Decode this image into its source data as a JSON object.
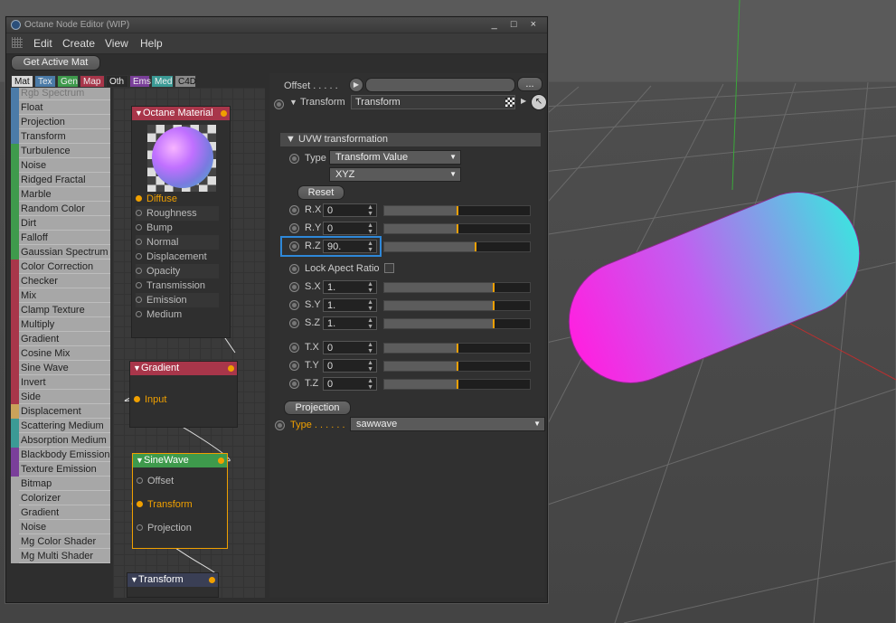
{
  "window": {
    "title": "Octane Node Editor (WIP)",
    "controls": [
      "_",
      "□",
      "×"
    ]
  },
  "menu": [
    "Edit",
    "Create",
    "View",
    "Help"
  ],
  "toolbar": {
    "get_active_mat": "Get Active Mat"
  },
  "tabs": [
    {
      "label": "Mat",
      "color": "#d9d9d9"
    },
    {
      "label": "Tex",
      "color": "#4b7ba8"
    },
    {
      "label": "Gen",
      "color": "#3e9a4c"
    },
    {
      "label": "Map",
      "color": "#a8364a"
    },
    {
      "label": "Oth",
      "color": "#2a2a2a"
    },
    {
      "label": "Ems",
      "color": "#7a3f9a"
    },
    {
      "label": "Med",
      "color": "#3b9a95"
    },
    {
      "label": "C4D",
      "color": "#8a8a8a"
    }
  ],
  "node_list": [
    {
      "label": "Rgb Spectrum",
      "color": "#4b7ba8"
    },
    {
      "label": "Float",
      "color": "#4b7ba8"
    },
    {
      "label": "Projection",
      "color": "#4b7ba8"
    },
    {
      "label": "Transform",
      "color": "#4b7ba8"
    },
    {
      "label": "Turbulence",
      "color": "#3e9a4c"
    },
    {
      "label": "Noise",
      "color": "#3e9a4c"
    },
    {
      "label": "Ridged Fractal",
      "color": "#3e9a4c"
    },
    {
      "label": "Marble",
      "color": "#3e9a4c"
    },
    {
      "label": "Random Color",
      "color": "#3e9a4c"
    },
    {
      "label": "Dirt",
      "color": "#3e9a4c"
    },
    {
      "label": "Falloff",
      "color": "#3e9a4c"
    },
    {
      "label": "Gaussian Spectrum",
      "color": "#3e9a4c"
    },
    {
      "label": "Color Correction",
      "color": "#a8364a"
    },
    {
      "label": "Checker",
      "color": "#a8364a"
    },
    {
      "label": "Mix",
      "color": "#a8364a"
    },
    {
      "label": "Clamp Texture",
      "color": "#a8364a"
    },
    {
      "label": "Multiply",
      "color": "#a8364a"
    },
    {
      "label": "Gradient",
      "color": "#a8364a"
    },
    {
      "label": "Cosine Mix",
      "color": "#a8364a"
    },
    {
      "label": "Sine Wave",
      "color": "#a8364a"
    },
    {
      "label": "Invert",
      "color": "#a8364a"
    },
    {
      "label": "Side",
      "color": "#a8364a"
    },
    {
      "label": "Displacement",
      "color": "#c9a25a"
    },
    {
      "label": "Scattering Medium",
      "color": "#3b9a95"
    },
    {
      "label": "Absorption Medium",
      "color": "#3b9a95"
    },
    {
      "label": "Blackbody Emission",
      "color": "#7a3f9a"
    },
    {
      "label": "Texture Emission",
      "color": "#7a3f9a"
    },
    {
      "label": "Bitmap",
      "color": "#a7a7a7"
    },
    {
      "label": "Colorizer",
      "color": "#a7a7a7"
    },
    {
      "label": "Gradient",
      "color": "#a7a7a7"
    },
    {
      "label": "Noise",
      "color": "#a7a7a7"
    },
    {
      "label": "Mg Color Shader",
      "color": "#a7a7a7"
    },
    {
      "label": "Mg Multi Shader",
      "color": "#a7a7a7"
    }
  ],
  "nodes": {
    "material": {
      "title": "Octane Material",
      "color": "#a8364a",
      "pins": [
        {
          "label": "Diffuse",
          "active": true
        },
        {
          "label": "Roughness",
          "active": false
        },
        {
          "label": "Bump",
          "active": false
        },
        {
          "label": "Normal",
          "active": false
        },
        {
          "label": "Displacement",
          "active": false
        },
        {
          "label": "Opacity",
          "active": false
        },
        {
          "label": "Transmission",
          "active": false
        },
        {
          "label": "Emission",
          "active": false
        },
        {
          "label": "Medium",
          "active": false
        }
      ]
    },
    "gradient": {
      "title": "Gradient",
      "color": "#a8364a",
      "pins": [
        {
          "label": "Input",
          "active": true
        }
      ]
    },
    "sinewave": {
      "title": "SineWave",
      "color": "#3e9a4c",
      "pins": [
        {
          "label": "Offset",
          "active": false
        },
        {
          "label": "Transform",
          "active": true
        },
        {
          "label": "Projection",
          "active": false
        }
      ]
    },
    "transform": {
      "title": "Transform",
      "color": "#3a3f55"
    }
  },
  "props": {
    "offset_label": "Offset . . . . .",
    "offset_more": "...",
    "transform_label": "Transform",
    "transform_value": "Transform",
    "uvw_section": "UVW transformation",
    "type_label": "Type",
    "type_value": "Transform Value",
    "order_value": "XYZ",
    "reset": "Reset",
    "rows": [
      {
        "label": "R.X",
        "value": "0",
        "level": 0.5
      },
      {
        "label": "R.Y",
        "value": "0",
        "level": 0.5
      },
      {
        "label": "R.Z",
        "value": "90.",
        "level": 0.625
      },
      {
        "label": "S.X",
        "value": "1.",
        "level": 0.75
      },
      {
        "label": "S.Y",
        "value": "1.",
        "level": 0.75
      },
      {
        "label": "S.Z",
        "value": "1.",
        "level": 0.75
      },
      {
        "label": "T.X",
        "value": "0",
        "level": 0.5
      },
      {
        "label": "T.Y",
        "value": "0",
        "level": 0.5
      },
      {
        "label": "T.Z",
        "value": "0",
        "level": 0.5
      }
    ],
    "lock_aspect": "Lock Apect Ratio",
    "projection_button": "Projection",
    "proj_type_label": "Type . . . . . .",
    "proj_type_value": "sawwave"
  },
  "colors": {
    "accent": "#f0a000",
    "selection": "#2e88d9"
  }
}
